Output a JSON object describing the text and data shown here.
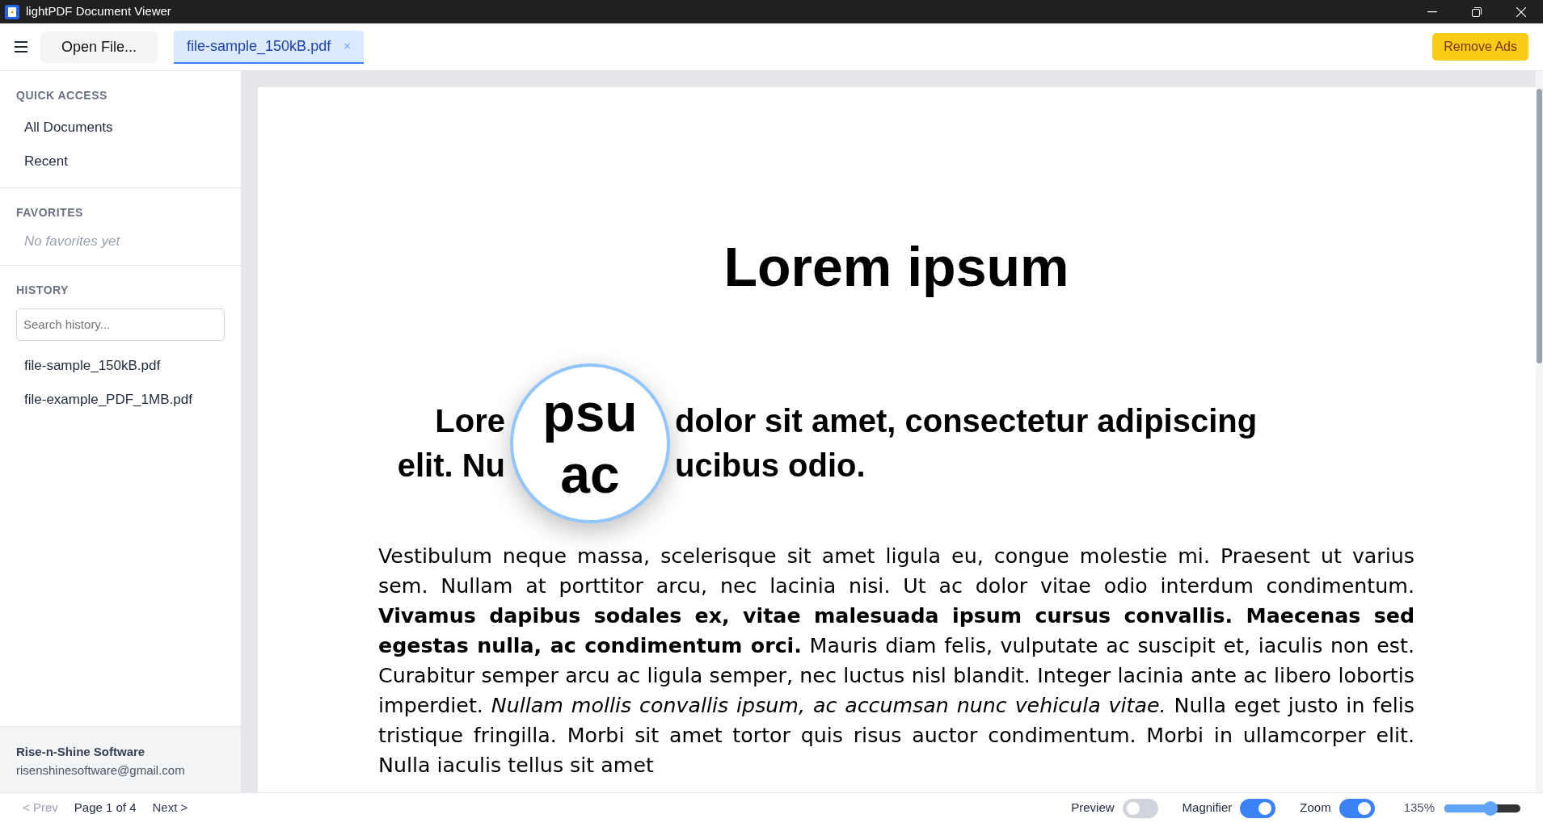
{
  "window": {
    "title": "lightPDF Document Viewer"
  },
  "toolbar": {
    "open_button": "Open File...",
    "tabs": [
      {
        "label": "file-sample_150kB.pdf",
        "close": "×",
        "selected": true
      }
    ],
    "remove_ads": "Remove Ads"
  },
  "sidebar": {
    "sections": [
      {
        "title": "QUICK ACCESS",
        "kind": "links",
        "items": [
          {
            "label": "All Documents"
          },
          {
            "label": "Recent"
          }
        ]
      },
      {
        "title": "FAVORITES",
        "kind": "empty",
        "empty_text": "No favorites yet"
      },
      {
        "title": "HISTORY",
        "kind": "history",
        "search": {
          "placeholder": "Search history..."
        },
        "items": [
          {
            "label": "file-sample_150kB.pdf"
          },
          {
            "label": "file-example_PDF_1MB.pdf"
          }
        ]
      }
    ],
    "footer": {
      "name": "Rise-n-Shine Software",
      "email": "risenshinesoftware@gmail.com"
    }
  },
  "document": {
    "title": "Lorem ipsum",
    "heading_lines": [
      {
        "left": "Lore",
        "right": "dolor sit amet, consectetur adipiscing"
      },
      {
        "left": "elit. Nu",
        "right": "ucibus odio."
      }
    ],
    "magnifier": {
      "lines": [
        "psu",
        "ac"
      ]
    },
    "paragraph": "Vestibulum neque massa, scelerisque sit amet ligula eu, congue molestie mi. Praesent ut varius sem. Nullam at porttitor arcu, nec lacinia nisi. Ut ac dolor vitae odio interdum condimentum. **Vivamus dapibus sodales ex, vitae malesuada ipsum cursus convallis. Maecenas sed egestas nulla, ac condimentum orci.** Mauris diam felis, vulputate ac suscipit et, iaculis non est. Curabitur semper arcu ac ligula semper, nec luctus nisl blandit. Integer lacinia ante ac libero lobortis imperdiet. *Nullam mollis convallis ipsum, ac accumsan nunc vehicula vitae.* Nulla eget justo in felis tristique fringilla. Morbi sit amet tortor quis risus auctor condimentum. Morbi in ullamcorper elit. Nulla iaculis tellus sit amet"
  },
  "status_bar": {
    "prev": {
      "label": "< Prev",
      "disabled": true
    },
    "page": "Page 1 of 4",
    "next": {
      "label": "Next >",
      "disabled": false
    },
    "toggles": [
      {
        "label": "Preview",
        "on": false
      },
      {
        "label": "Magnifier",
        "on": true
      },
      {
        "label": "Zoom",
        "on": true
      }
    ],
    "zoom": {
      "reading": "135%",
      "level": 0.61
    }
  }
}
